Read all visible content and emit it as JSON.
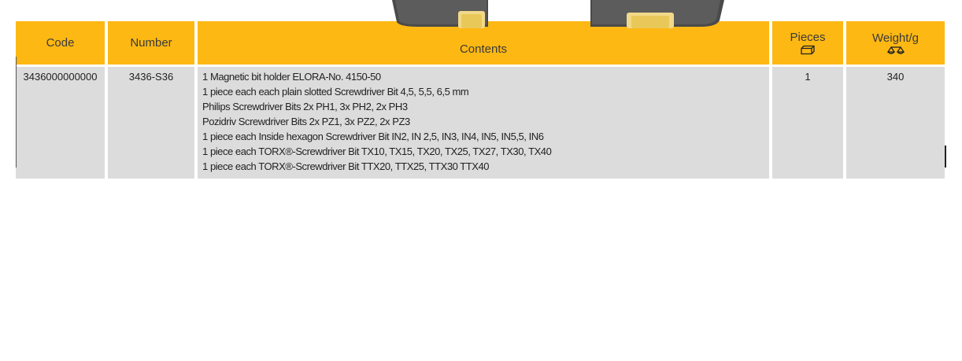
{
  "table": {
    "headers": {
      "code": "Code",
      "number": "Number",
      "contents": "Contents",
      "pieces": "Pieces",
      "weight": "Weight/g"
    },
    "header_icons": {
      "pieces": "pieces-box-icon",
      "weight": "scale-balance-icon"
    },
    "rows": [
      {
        "code": "3436000000000",
        "number": "3436-S36",
        "contents": [
          "1 Magnetic bit holder ELORA-No. 4150-50",
          "1 piece each each plain slotted Screwdriver Bit 4,5, 5,5, 6,5 mm",
          "Philips Screwdriver Bits 2x PH1, 3x PH2, 2x PH3",
          "Pozidriv Screwdriver Bits 2x PZ1, 3x PZ2, 2x PZ3",
          "1 piece each Inside hexagon Screwdriver Bit IN2, IN 2,5, IN3, IN4, IN5, IN5,5, IN6",
          "1 piece each TORX®-Screwdriver Bit TX10, TX15, TX20, TX25, TX27, TX30, TX40",
          "1 piece each TORX®-Screwdriver Bit TTX20, TTX25, TTX30 TTX40"
        ],
        "pieces": "1",
        "weight": "340"
      }
    ]
  },
  "colors": {
    "header_bg": "#fdb813",
    "row_bg": "#dcdcdc",
    "header_text": "#3a3a3a"
  }
}
